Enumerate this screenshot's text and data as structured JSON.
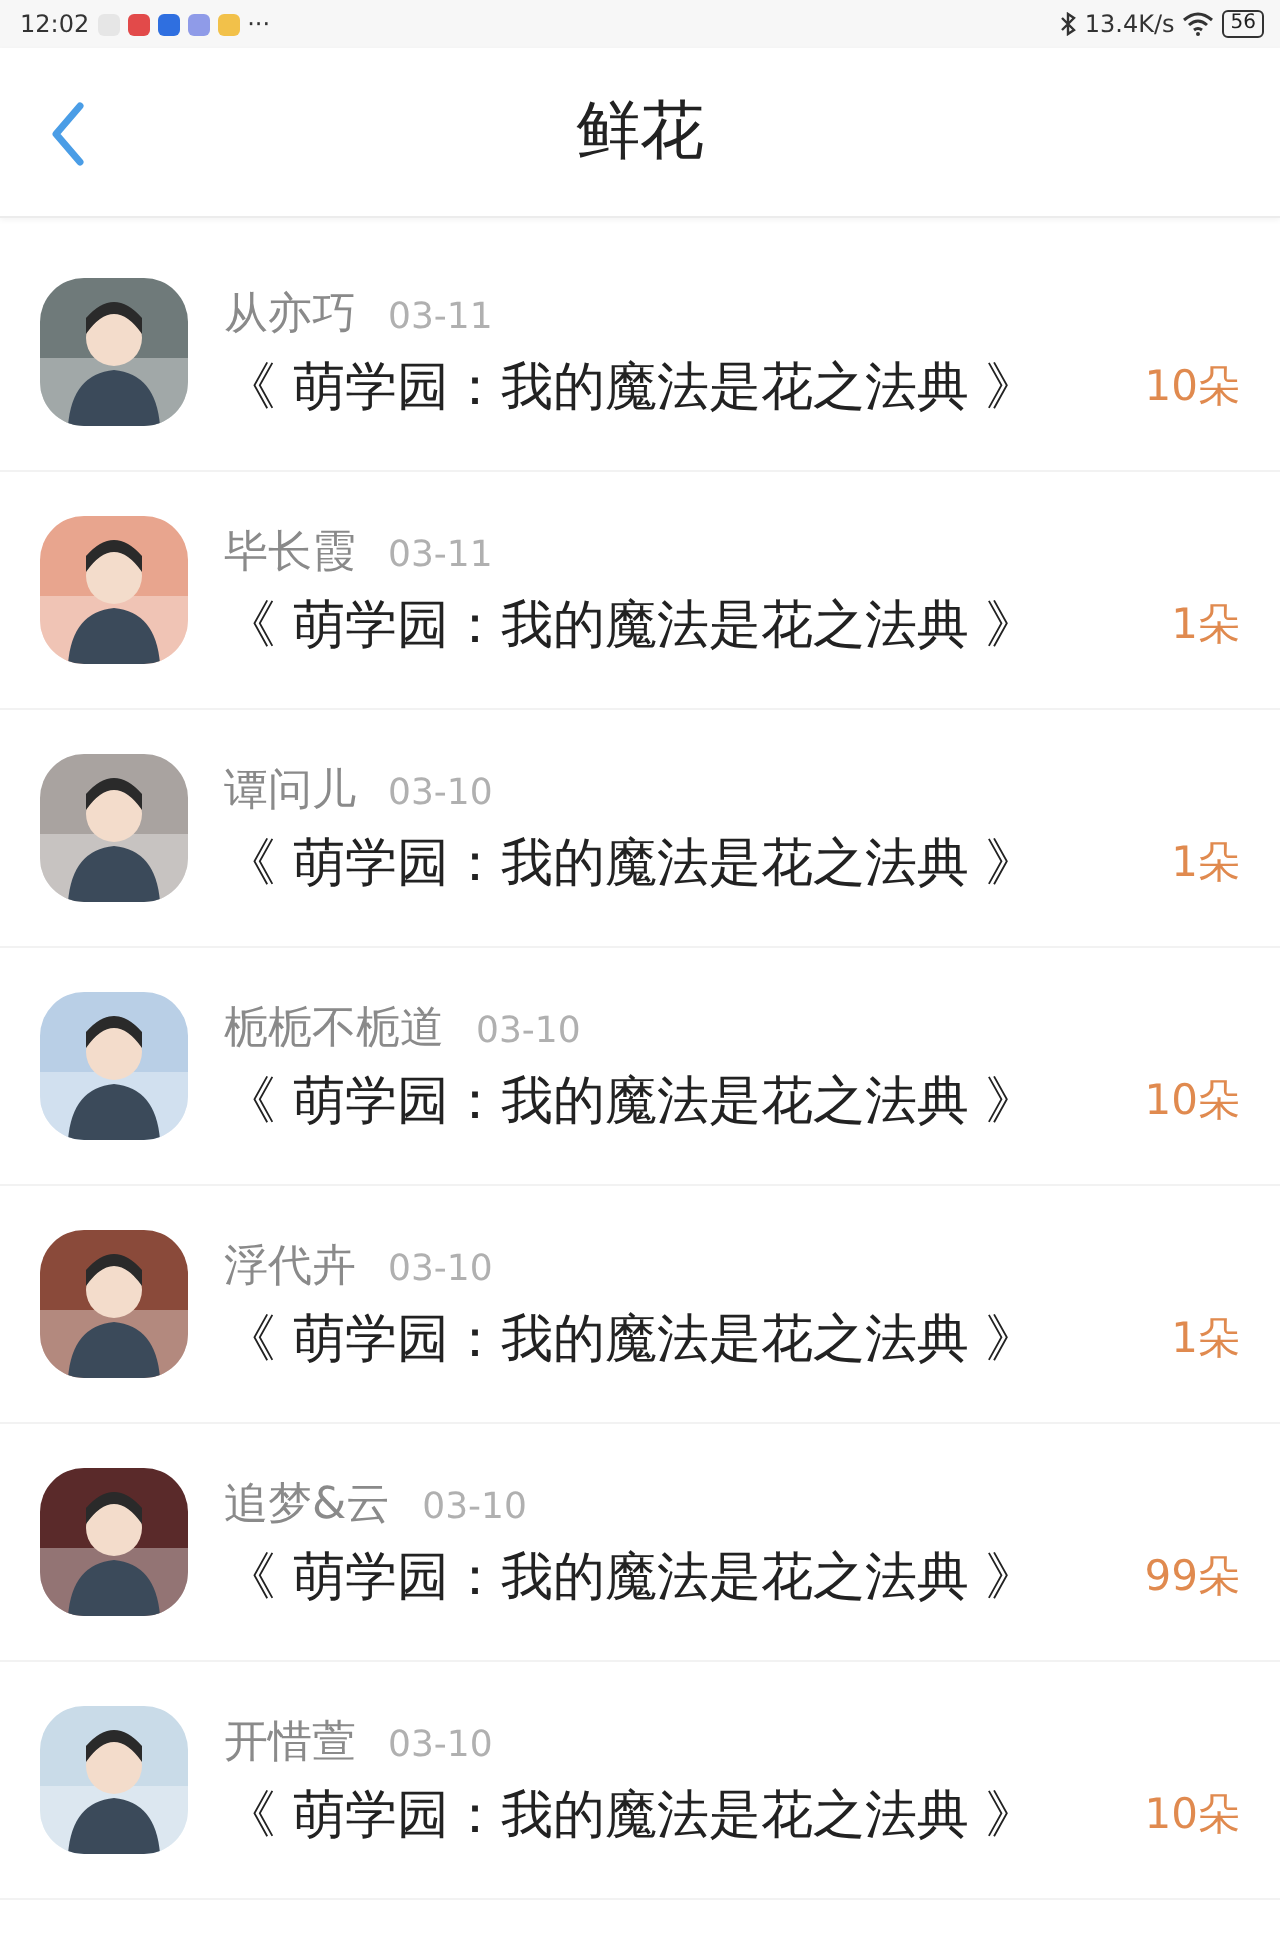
{
  "status_bar": {
    "time": "12:02",
    "more": "···",
    "speed": "13.4K/s",
    "battery": "56"
  },
  "header": {
    "title": "鲜花"
  },
  "gifts": [
    {
      "name": "从亦巧",
      "date": "03-11",
      "book": "《 萌学园：我的魔法是花之法典 》",
      "amount": "10朵"
    },
    {
      "name": "毕长霞",
      "date": "03-11",
      "book": "《 萌学园：我的魔法是花之法典 》",
      "amount": "1朵"
    },
    {
      "name": "谭问儿",
      "date": "03-10",
      "book": "《 萌学园：我的魔法是花之法典 》",
      "amount": "1朵"
    },
    {
      "name": "栀栀不栀道",
      "date": "03-10",
      "book": "《 萌学园：我的魔法是花之法典 》",
      "amount": "10朵"
    },
    {
      "name": "浮代卉",
      "date": "03-10",
      "book": "《 萌学园：我的魔法是花之法典 》",
      "amount": "1朵"
    },
    {
      "name": "追梦&云",
      "date": "03-10",
      "book": "《 萌学园：我的魔法是花之法典 》",
      "amount": "99朵"
    },
    {
      "name": "开惜萱",
      "date": "03-10",
      "book": "《 萌学园：我的魔法是花之法典 》",
      "amount": "10朵"
    }
  ]
}
